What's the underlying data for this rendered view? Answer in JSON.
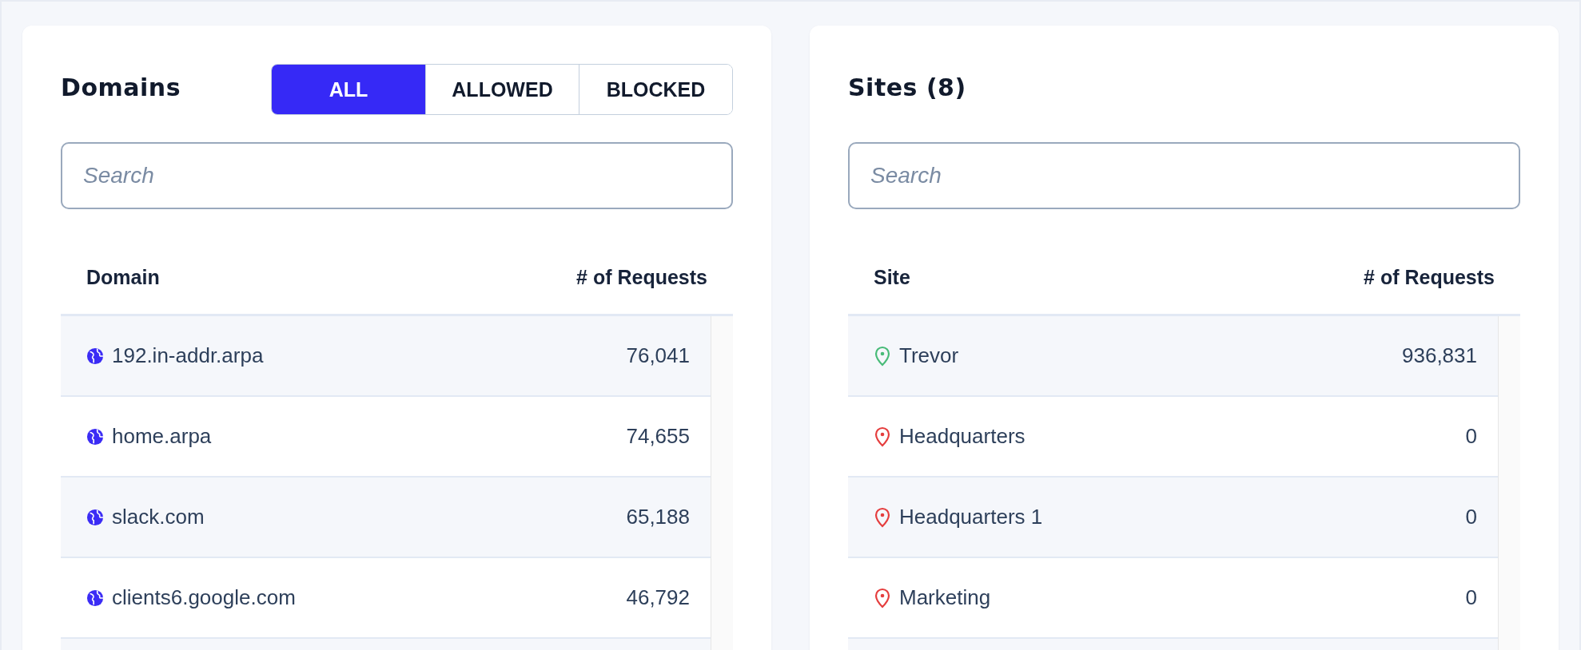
{
  "domains": {
    "title": "Domains",
    "filters": [
      {
        "label": "ALL",
        "selected": true
      },
      {
        "label": "ALLOWED",
        "selected": false
      },
      {
        "label": "BLOCKED",
        "selected": false
      }
    ],
    "search": {
      "placeholder": "Search"
    },
    "table": {
      "columns": [
        "Domain",
        "# of Requests"
      ],
      "rows": [
        {
          "name": "192.in-addr.arpa",
          "requests": "76,041"
        },
        {
          "name": "home.arpa",
          "requests": "74,655"
        },
        {
          "name": "slack.com",
          "requests": "65,188"
        },
        {
          "name": "clients6.google.com",
          "requests": "46,792"
        }
      ]
    }
  },
  "sites": {
    "title": "Sites (8)",
    "search": {
      "placeholder": "Search"
    },
    "table": {
      "columns": [
        "Site",
        "# of Requests"
      ],
      "rows": [
        {
          "name": "Trevor",
          "requests": "936,831",
          "color": "#48bb78"
        },
        {
          "name": "Headquarters",
          "requests": "0",
          "color": "#e53e3e"
        },
        {
          "name": "Headquarters 1",
          "requests": "0",
          "color": "#e53e3e"
        },
        {
          "name": "Marketing",
          "requests": "0",
          "color": "#e53e3e"
        }
      ]
    }
  }
}
